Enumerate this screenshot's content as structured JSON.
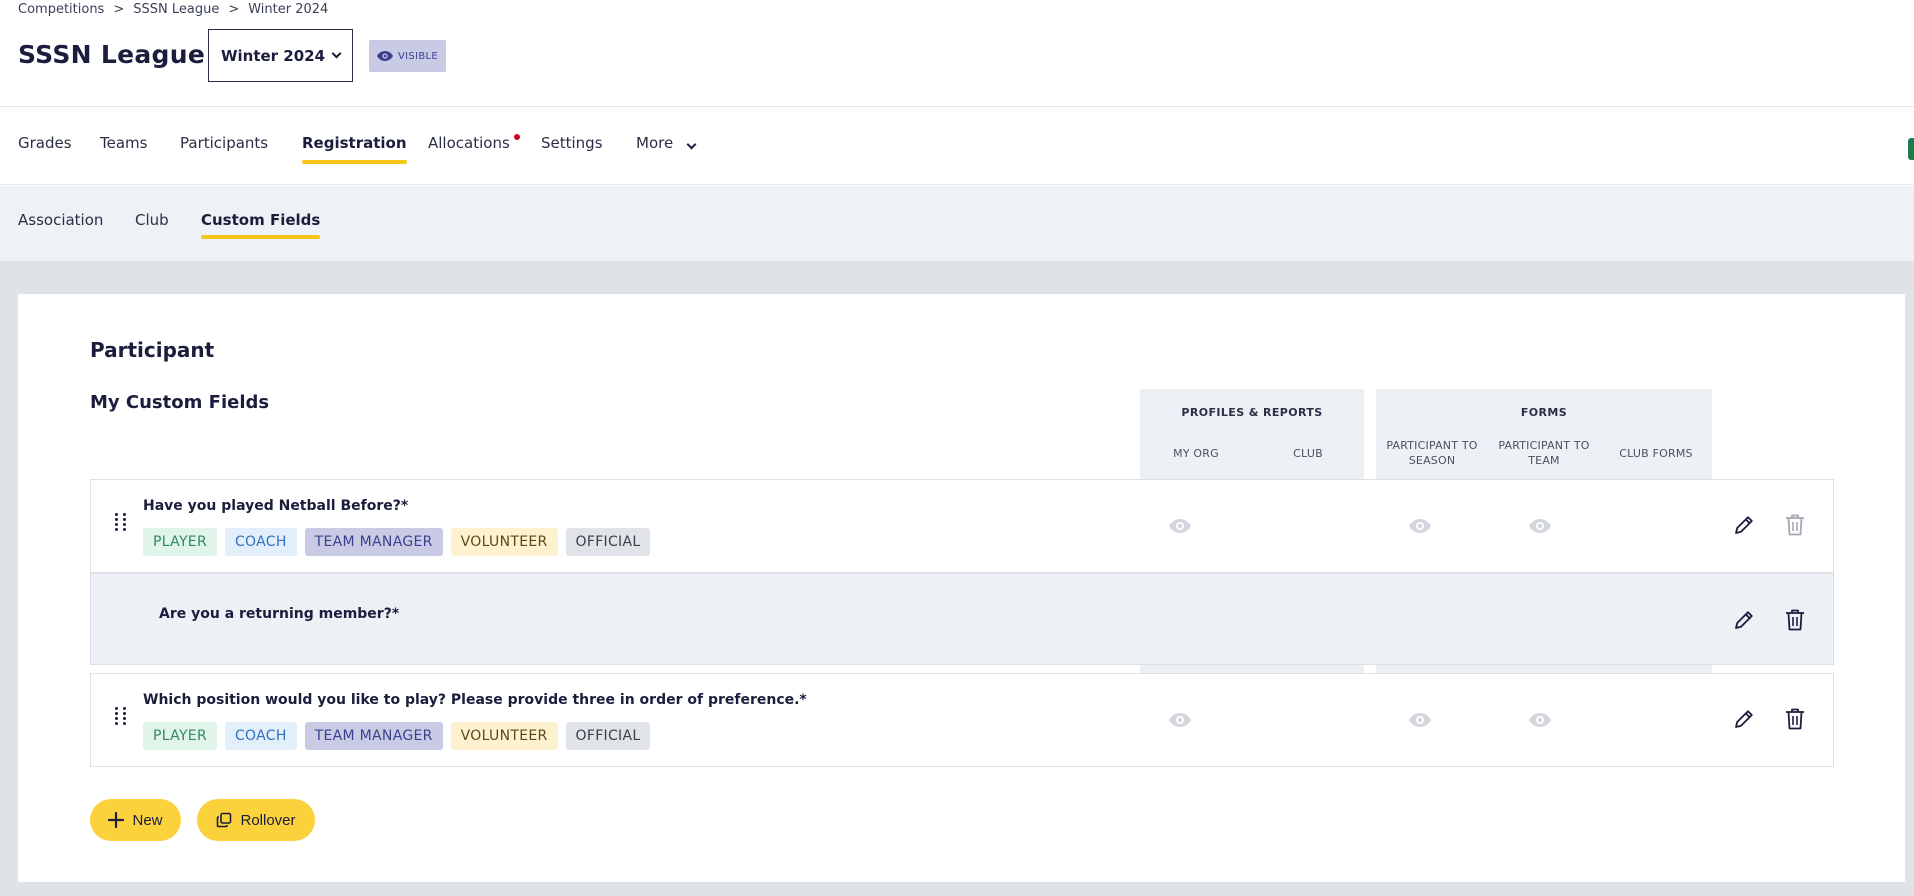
{
  "breadcrumb": {
    "items": [
      "Competitions",
      "SSSN League",
      "Winter 2024"
    ],
    "separator": ">"
  },
  "header": {
    "title": "SSSN League",
    "season_select": "Winter 2024",
    "visibility_badge": "VISIBLE"
  },
  "main_nav": {
    "items": [
      "Grades",
      "Teams",
      "Participants",
      "Registration",
      "Allocations",
      "Settings",
      "More"
    ],
    "active": "Registration",
    "notification_on": "Allocations"
  },
  "sub_nav": {
    "items": [
      "Association",
      "Club",
      "Custom Fields"
    ],
    "active": "Custom Fields"
  },
  "section": {
    "title": "Participant",
    "subtitle": "My Custom Fields"
  },
  "columns": {
    "profiles_group": "PROFILES & REPORTS",
    "forms_group": "FORMS",
    "my_org": "MY ORG",
    "club": "CLUB",
    "participant_to_season": "PARTICIPANT TO SEASON",
    "participant_to_team": "PARTICIPANT TO TEAM",
    "club_forms": "CLUB FORMS"
  },
  "fields": [
    {
      "question": "Have you played Netball Before?*",
      "tags": [
        "PLAYER",
        "COACH",
        "TEAM MANAGER",
        "VOLUNTEER",
        "OFFICIAL"
      ]
    },
    {
      "question": "Are you a returning member?*",
      "tags": []
    },
    {
      "question": "Which position would you like to play? Please provide three in order of preference.*",
      "tags": [
        "PLAYER",
        "COACH",
        "TEAM MANAGER",
        "VOLUNTEER",
        "OFFICIAL"
      ]
    }
  ],
  "buttons": {
    "new": "New",
    "rollover": "Rollover"
  },
  "colors": {
    "accent": "#fcd23c",
    "active_underline": "#f5c518",
    "notification": "#d0021b",
    "badge_bg": "#c9cbe4",
    "badge_text": "#3b4190"
  },
  "icons": {
    "visible_badge": "eye-icon",
    "visibility_toggle": "eye-icon",
    "edit": "pencil-icon",
    "delete": "trash-icon",
    "drag": "drag-handle-icon",
    "new": "plus-icon",
    "rollover": "copy-icon",
    "season_dropdown": "chevron-down-icon"
  }
}
